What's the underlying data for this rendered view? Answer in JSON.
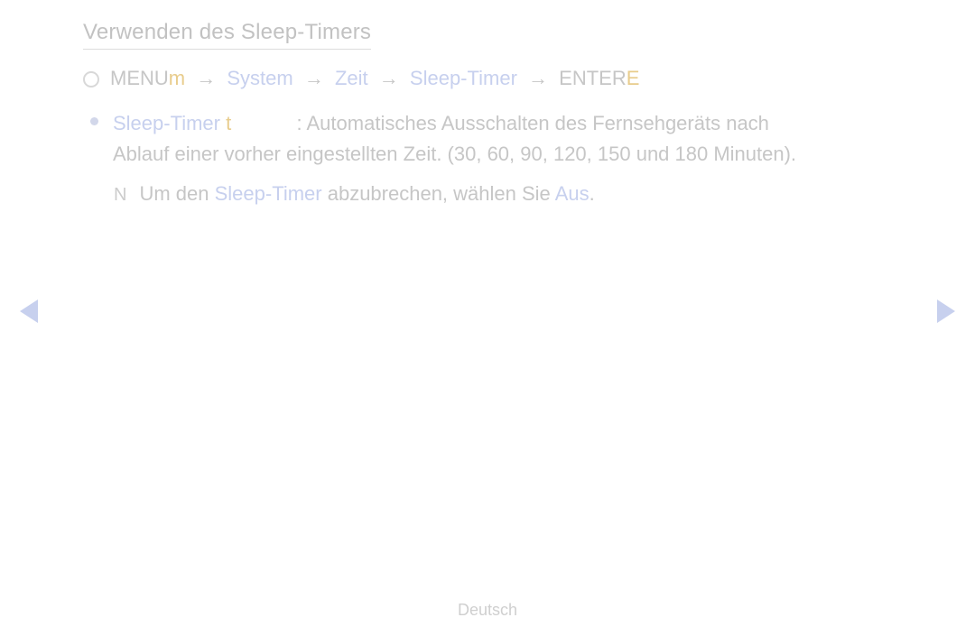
{
  "title": "Verwenden des Sleep-Timers",
  "path": {
    "p1": "MENU",
    "p1_suffix": "m",
    "p2": "System",
    "p3": "Zeit",
    "p4": "Sleep-Timer",
    "p5": "ENTER",
    "p5_suffix": "E",
    "arrow": "→"
  },
  "item": {
    "label": "Sleep-Timer",
    "label_suffix": "t",
    "desc_a": ": Automatisches Ausschalten des Fernsehgeräts nach",
    "desc_b": "Ablauf einer vorher eingestellten Zeit. (30, 60, 90, 120, 150 und 180 Minuten)."
  },
  "note": {
    "marker": "N",
    "t1": "Um den ",
    "t2": "Sleep-Timer",
    "t3": " abzubrechen, wählen Sie ",
    "t4": "Aus",
    "t5": "."
  },
  "footer": "Deutsch"
}
